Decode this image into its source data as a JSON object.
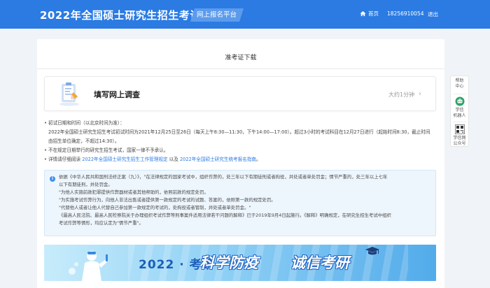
{
  "header": {
    "site_title": "2022年全国硕士研究生招生考试",
    "platform_badge": "网上报名平台",
    "nav_home": "首页",
    "nav_phone": "18256910054",
    "nav_logout": "退出"
  },
  "card": {
    "title": "准考证下载"
  },
  "survey": {
    "title": "填写网上调查",
    "duration": "大约1分钟",
    "chevron": "›"
  },
  "notes": {
    "line1": "初试日期和时间（以北京时间为准）：",
    "line2": "2022年全国硕士研究生招生考试初试时间为2021年12月25日至26日（每天上午8:30—11:30，下午14:00—17:00）。超过3小时的考试科目在12月27日进行（起始时间8:30，截止时间",
    "line3": "由招生单位确定，不超过14:30）。",
    "line4": "不在规定日期举行的研究生招生考试，国家一律不予承认。",
    "line5_prefix": "详情请仔细阅读 ",
    "line5_link1": "2022年全国硕士研究生招生工作管理规定",
    "line5_mid": " 以及 ",
    "line5_link2": "2022年全国硕士研究生统考报名指南",
    "line5_suffix": "。"
  },
  "law_box": {
    "info_icon": "i",
    "line1": "依据《中华人民共和国刑法修正案（九）》，\"在法律规定的国家考试中，组织作弊的，处三年以下有期徒刑或者拘役，并处或者单处罚金；情节严重的，处三年以上七年",
    "line2": "以下有期徒刑，并处罚金。",
    "line3": "\"为他人实施前款犯罪提供作弊器材或者其他帮助的，依照前款的规定处罚。",
    "line4": "\"为实施考试作弊行为，向他人非法出售或者提供第一款规定的考试的试题、答案的，依照第一款的规定处罚。",
    "line5": "\"代替他人或者让他人代替自己参加第一款规定的考试的，处拘役或者管制，并处或者单处罚金。\"",
    "line6": "《最高人民法院、最高人民检察院关于办理组织考试作弊等刑事案件适用法律若干问题的解释》已于2019年9月4日起施行。《解释》明确规定，在研究生招生考试中组织",
    "line7": "考试作弊等情形，均应认定为\"情节严重\"。"
  },
  "banner": {
    "year": "2022 · 考研",
    "slogan1": "科学防疫",
    "slogan2": "诚信考研"
  },
  "side_panel": {
    "help_line1": "帮助",
    "help_line2": "中心",
    "robot_line1": "学信",
    "robot_line2": "机器人",
    "wechat_line1": "学信网",
    "wechat_line2": "公众号"
  },
  "colors": {
    "header_bg": "#2b7be3",
    "link": "#2b7be3",
    "page_bg": "#f0f3f7",
    "notice_bg": "#eef6fd"
  }
}
